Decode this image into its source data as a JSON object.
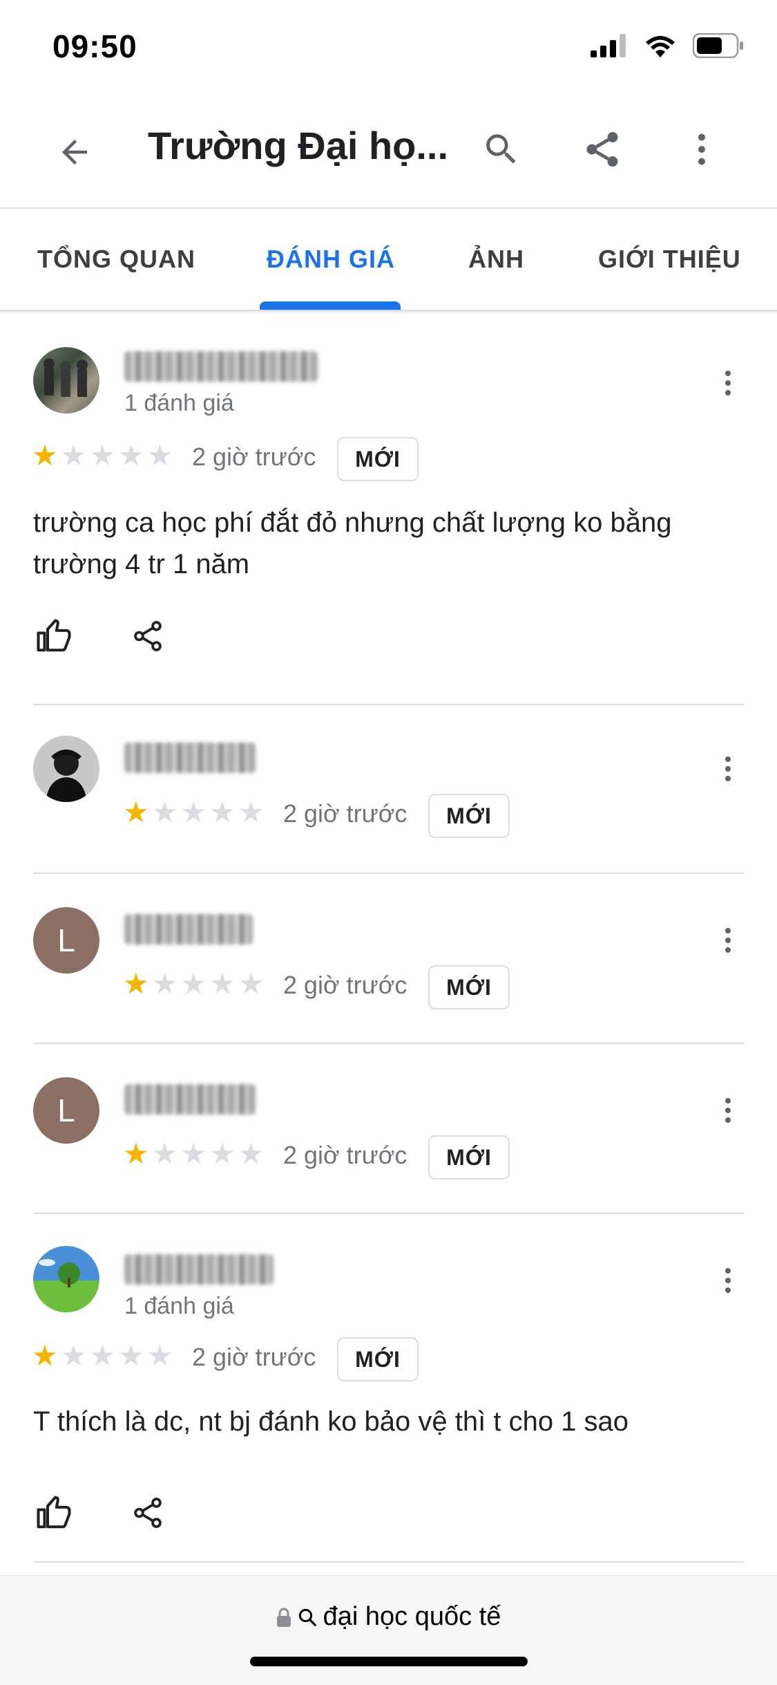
{
  "status_bar": {
    "time": "09:50"
  },
  "app_bar": {
    "title": "Trường Đại họ..."
  },
  "tabs": [
    {
      "label": "TỔNG QUAN",
      "active": false
    },
    {
      "label": "ĐÁNH GIÁ",
      "active": true
    },
    {
      "label": "ẢNH",
      "active": false
    },
    {
      "label": "GIỚI THIỆU",
      "active": false
    }
  ],
  "reviews": [
    {
      "author_count": "1 đánh giá",
      "rating": 1,
      "time": "2 giờ trước",
      "badge": "MỚI",
      "text": "trường ca học phí đắt đỏ nhưng chất lượng ko bằng trường 4 tr 1 năm"
    },
    {
      "rating": 1,
      "time": "2 giờ trước",
      "badge": "MỚI"
    },
    {
      "avatar_letter": "L",
      "rating": 1,
      "time": "2 giờ trước",
      "badge": "MỚI"
    },
    {
      "avatar_letter": "L",
      "rating": 1,
      "time": "2 giờ trước",
      "badge": "MỚI"
    },
    {
      "author_count": "1 đánh giá",
      "rating": 1,
      "time": "2 giờ trước",
      "badge": "MỚI",
      "text": "T thích là dc, nt bj đánh ko bảo vệ thì t cho 1 sao"
    }
  ],
  "url_bar": {
    "query": "đại học quốc tế"
  },
  "colors": {
    "accent": "#1a73e8",
    "star_on": "#f4b400",
    "star_off": "#dadce0",
    "avatar_letter_bg": "#8d6e63"
  },
  "icons": [
    "back-arrow-icon",
    "search-icon",
    "share-icon",
    "more-vert-icon",
    "thumb-up-icon",
    "lock-icon"
  ]
}
